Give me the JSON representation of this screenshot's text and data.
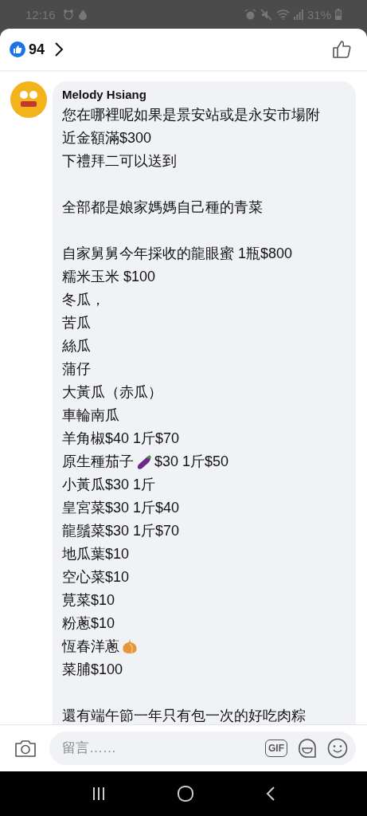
{
  "status_bar": {
    "time": "12:16",
    "battery": "31%"
  },
  "header": {
    "like_count": "94"
  },
  "comment": {
    "author": "Melody Hsiang",
    "paragraphs": [
      [
        {
          "text": "您在哪裡呢如果是景安站或是永安市場附"
        },
        {
          "text": "近金額滿$300"
        },
        {
          "text": "下禮拜二可以送到"
        }
      ],
      [
        {
          "text": "全部都是娘家媽媽自己種的青菜"
        }
      ],
      [
        {
          "text": "自家舅舅今年採收的龍眼蜜 1瓶$800"
        },
        {
          "text": "糯米玉米 $100"
        },
        {
          "text": "冬瓜，"
        },
        {
          "text": "苦瓜"
        },
        {
          "text": "絲瓜"
        },
        {
          "text": "蒲仔"
        },
        {
          "text": "大黃瓜（赤瓜）"
        },
        {
          "text": "車輪南瓜"
        },
        {
          "text": "羊角椒$40 1斤$70"
        },
        {
          "text": "原生種茄子",
          "kind": "eggplant",
          "after": " $30 1斤$50"
        },
        {
          "text": "小黃瓜$30 1斤"
        },
        {
          "text": "皇宮菜$30 1斤$40"
        },
        {
          "text": "龍鬚菜$30 1斤$70"
        },
        {
          "text": "地瓜葉$10"
        },
        {
          "text": "空心菜$10"
        },
        {
          "text": "莧菜$10"
        },
        {
          "text": "粉蔥$10"
        },
        {
          "text": "恆春洋蔥",
          "kind": "onion"
        },
        {
          "text": "菜脯$100"
        }
      ],
      [
        {
          "text": "還有端午節一年只有包一次的好吃肉粽"
        }
      ]
    ]
  },
  "composer": {
    "placeholder": "留言……",
    "gif_label": "GIF"
  }
}
